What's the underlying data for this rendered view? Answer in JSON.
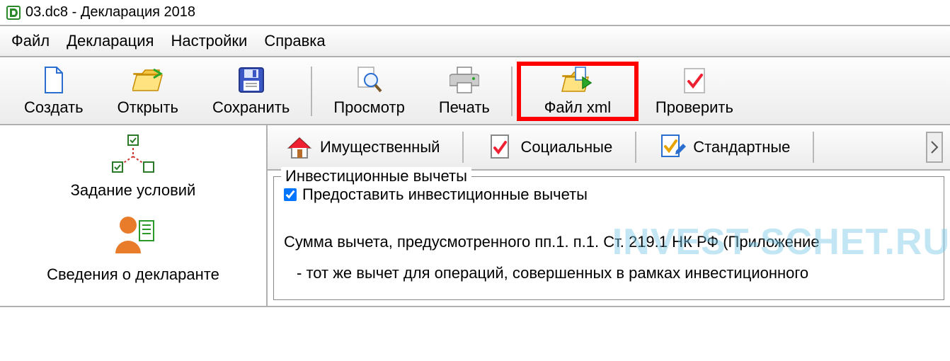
{
  "title": "03.dc8 - Декларация 2018",
  "menus": {
    "file": "Файл",
    "decl": "Декларация",
    "settings": "Настройки",
    "help": "Справка"
  },
  "toolbar": {
    "create": "Создать",
    "open": "Открыть",
    "save": "Сохранить",
    "preview": "Просмотр",
    "print": "Печать",
    "xml": "Файл xml",
    "check": "Проверить"
  },
  "sidebar": {
    "item1": "Задание условий",
    "item2": "Сведения о декларанте"
  },
  "tabs": {
    "property": "Имущественный",
    "social": "Социальные",
    "standard": "Стандартные"
  },
  "fieldset": {
    "legend": "Инвестиционные вычеты",
    "checkbox_label": "Предоставить инвестиционные вычеты"
  },
  "text": {
    "line1": "Сумма вычета, предусмотренного пп.1. п.1. Ст. 219.1 НК РФ (Приложение",
    "line2": "- тот же вычет для операций, совершенных в рамках инвестиционного"
  },
  "watermark": "INVEST-SCHET.RU"
}
